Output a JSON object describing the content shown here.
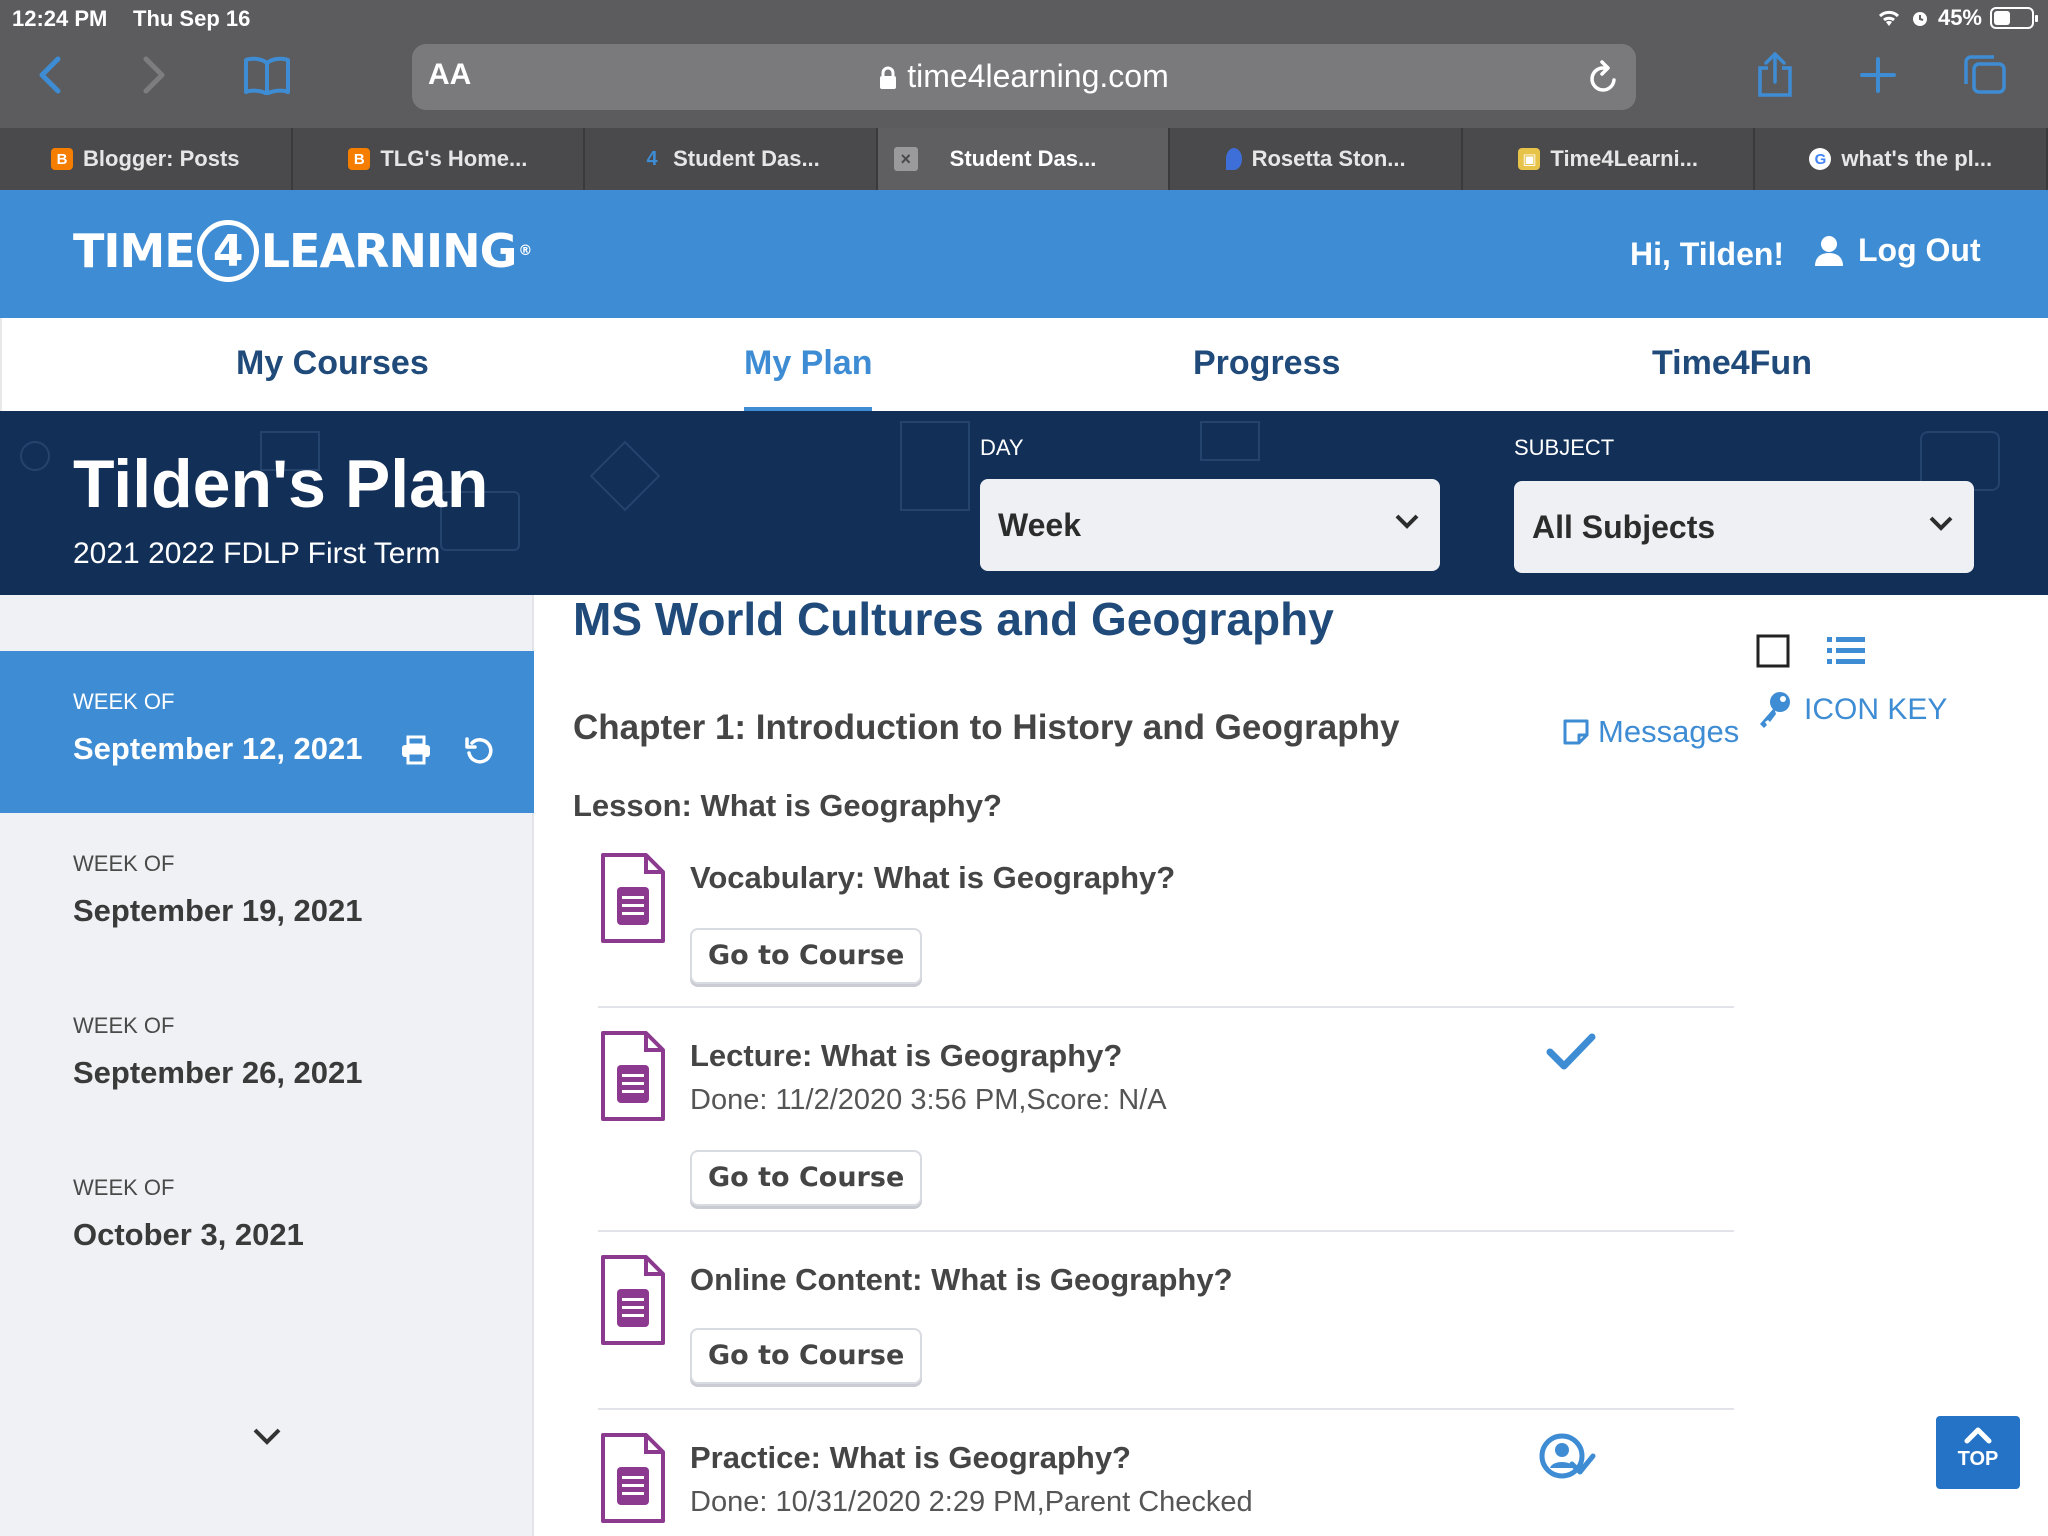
{
  "status_bar": {
    "time": "12:24 PM",
    "date": "Thu Sep 16",
    "battery": "45%"
  },
  "browser": {
    "aa_label": "AA",
    "url": "time4learning.com",
    "tabs": [
      {
        "label": "Blogger: Posts",
        "icon": "blogger-icon"
      },
      {
        "label": "TLG's Home...",
        "icon": "blogger-icon"
      },
      {
        "label": "Student Das...",
        "icon": "time4learning-icon"
      },
      {
        "label": "Student Das...",
        "icon": "close-icon",
        "active": true
      },
      {
        "label": "Rosetta Ston...",
        "icon": "rosetta-icon"
      },
      {
        "label": "Time4Learni...",
        "icon": "image-icon"
      },
      {
        "label": "what's the pl...",
        "icon": "google-icon"
      }
    ]
  },
  "header": {
    "logo_left": "TIME",
    "logo_num": "4",
    "logo_right": "LEARNING",
    "logo_reg": "®",
    "greeting": "Hi, Tilden!",
    "logout_label": "Log Out"
  },
  "nav": {
    "items": [
      {
        "label": "My Courses"
      },
      {
        "label": "My Plan",
        "active": true
      },
      {
        "label": "Progress"
      },
      {
        "label": "Time4Fun"
      }
    ]
  },
  "plan": {
    "title": "Tilden's Plan",
    "term": "2021 2022 FDLP First Term",
    "day_label": "DAY",
    "day_value": "Week",
    "subject_label": "SUBJECT",
    "subject_value": "All Subjects"
  },
  "sidebar": {
    "weeks": [
      {
        "label": "WEEK OF",
        "date": "September 12, 2021",
        "active": true
      },
      {
        "label": "WEEK OF",
        "date": "September 19, 2021"
      },
      {
        "label": "WEEK OF",
        "date": "September 26, 2021"
      },
      {
        "label": "WEEK OF",
        "date": "October 3, 2021"
      }
    ]
  },
  "main": {
    "course_title": "MS World Cultures and Geography",
    "chapter": "Chapter 1: Introduction to History and Geography",
    "messages_label": "Messages",
    "icon_key_label": "ICON KEY",
    "lesson": "Lesson: What is Geography?",
    "activities": [
      {
        "title": "Vocabulary: What is Geography?",
        "done": "",
        "button": "Go to Course",
        "status": "none"
      },
      {
        "title": "Lecture: What is Geography?",
        "done": "Done: 11/2/2020 3:56 PM,Score: N/A",
        "button": "Go to Course",
        "status": "check-icon"
      },
      {
        "title": "Online Content: What is Geography?",
        "done": "",
        "button": "Go to Course",
        "status": "none"
      },
      {
        "title": "Practice: What is Geography?",
        "done": "Done: 10/31/2020 2:29 PM,Parent Checked",
        "button": "",
        "status": "parent-checked-icon"
      }
    ],
    "top_label": "TOP"
  },
  "colors": {
    "brand_blue": "#3e8cd3",
    "navy": "#122f57",
    "title_blue": "#1f4a7a",
    "doc_purple": "#8b3a8f"
  }
}
